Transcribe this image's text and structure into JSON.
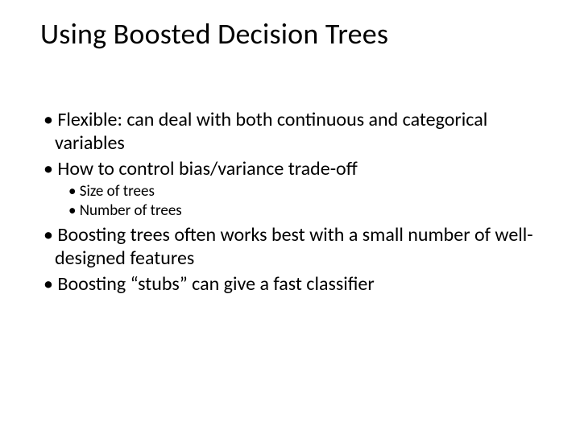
{
  "title": "Using Boosted Decision Trees",
  "bullets": {
    "b1": "Flexible: can deal with both continuous and categorical variables",
    "b2": "How to control bias/variance trade-off",
    "b2a": "Size of trees",
    "b2b": "Number of trees",
    "b3": "Boosting trees often works best with a small number of well-designed features",
    "b4": "Boosting “stubs” can give a fast classifier"
  }
}
